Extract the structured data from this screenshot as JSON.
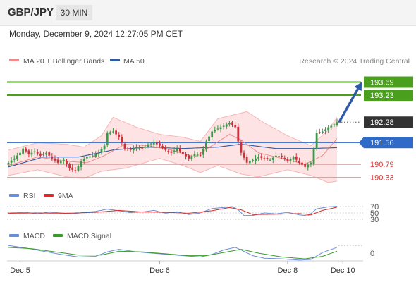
{
  "header": {
    "pair": "GBP/JPY",
    "timeframe": "30 MIN"
  },
  "datetime": "Monday, December 9, 2024 12:27:05 PM CET",
  "source": "Research © 2024 Trading Central",
  "colors": {
    "green": "#4aa01c",
    "blue_level": "#2f6ac8",
    "red_level": "#e88f8f",
    "arrow": "#2e5aa8",
    "candle_up": "#3a9a4a",
    "candle_down": "#c9313b",
    "rsi": "#6b8ed8",
    "rsi_ma": "#d62c2c",
    "macd": "#6b8ed8",
    "macd_signal": "#3a9a2a"
  },
  "chart_data": {
    "type": "candlestick",
    "price_range": [
      189.95,
      194.15
    ],
    "legend": [
      {
        "label": "MA 20 + Bollinger Bands",
        "color": "#f08a8a"
      },
      {
        "label": "MA 50",
        "color": "#2d5aa0"
      }
    ],
    "levels": [
      {
        "value": 193.69,
        "label": "193.69",
        "style": "green"
      },
      {
        "value": 193.23,
        "label": "193.23",
        "style": "green"
      },
      {
        "value": 192.28,
        "label": "192.28",
        "style": "current"
      },
      {
        "value": 191.56,
        "label": "191.56",
        "style": "blue"
      },
      {
        "value": 190.79,
        "label": "190.79",
        "style": "red"
      },
      {
        "value": 190.33,
        "label": "190.33",
        "style": "red"
      }
    ],
    "forecast_arrow": {
      "from": 192.28,
      "to": 193.69
    },
    "x_ticks": [
      {
        "label": "Dec 5",
        "bar": 4
      },
      {
        "label": "Dec 6",
        "bar": 52
      },
      {
        "label": "Dec 8",
        "bar": 96
      },
      {
        "label": "Dec 10",
        "bar": 115
      }
    ],
    "series": [
      {
        "name": "close",
        "anchors": [
          [
            0,
            190.85
          ],
          [
            2,
            191.0
          ],
          [
            4,
            191.2
          ],
          [
            5,
            191.35
          ],
          [
            7,
            191.15
          ],
          [
            9,
            191.25
          ],
          [
            11,
            191.1
          ],
          [
            13,
            191.2
          ],
          [
            15,
            191.0
          ],
          [
            17,
            190.85
          ],
          [
            19,
            190.95
          ],
          [
            21,
            190.65
          ],
          [
            23,
            190.55
          ],
          [
            25,
            190.9
          ],
          [
            27,
            191.05
          ],
          [
            29,
            191.1
          ],
          [
            31,
            191.2
          ],
          [
            33,
            191.45
          ],
          [
            34,
            191.9
          ],
          [
            36,
            191.95
          ],
          [
            38,
            191.75
          ],
          [
            40,
            191.35
          ],
          [
            42,
            191.3
          ],
          [
            44,
            191.4
          ],
          [
            46,
            191.35
          ],
          [
            48,
            191.5
          ],
          [
            50,
            191.55
          ],
          [
            52,
            191.45
          ],
          [
            54,
            191.3
          ],
          [
            56,
            191.2
          ],
          [
            58,
            191.35
          ],
          [
            60,
            191.15
          ],
          [
            62,
            191.0
          ],
          [
            64,
            191.15
          ],
          [
            66,
            191.1
          ],
          [
            68,
            191.6
          ],
          [
            70,
            191.95
          ],
          [
            72,
            192.05
          ],
          [
            74,
            192.15
          ],
          [
            76,
            192.25
          ],
          [
            78,
            192.1
          ],
          [
            79,
            191.6
          ],
          [
            80,
            191.2
          ],
          [
            82,
            190.85
          ],
          [
            84,
            190.95
          ],
          [
            86,
            191.05
          ],
          [
            88,
            191.0
          ],
          [
            90,
            190.95
          ],
          [
            92,
            191.1
          ],
          [
            94,
            191.05
          ],
          [
            96,
            190.9
          ],
          [
            98,
            191.05
          ],
          [
            100,
            190.85
          ],
          [
            102,
            190.7
          ],
          [
            104,
            190.85
          ],
          [
            105,
            191.35
          ],
          [
            106,
            191.9
          ],
          [
            108,
            191.95
          ],
          [
            110,
            192.1
          ],
          [
            112,
            192.2
          ],
          [
            113,
            192.28
          ]
        ]
      },
      {
        "name": "MA 20",
        "anchors": [
          [
            0,
            190.75
          ],
          [
            10,
            191.05
          ],
          [
            20,
            190.9
          ],
          [
            27,
            190.85
          ],
          [
            33,
            191.1
          ],
          [
            40,
            191.5
          ],
          [
            48,
            191.45
          ],
          [
            56,
            191.3
          ],
          [
            64,
            191.05
          ],
          [
            70,
            191.45
          ],
          [
            76,
            191.85
          ],
          [
            80,
            191.65
          ],
          [
            86,
            191.2
          ],
          [
            94,
            191.0
          ],
          [
            102,
            190.8
          ],
          [
            108,
            191.1
          ],
          [
            113,
            191.7
          ]
        ]
      },
      {
        "name": "MA 50",
        "anchors": [
          [
            0,
            190.7
          ],
          [
            12,
            191.05
          ],
          [
            24,
            191.05
          ],
          [
            36,
            191.3
          ],
          [
            48,
            191.4
          ],
          [
            60,
            191.35
          ],
          [
            72,
            191.4
          ],
          [
            80,
            191.5
          ],
          [
            92,
            191.35
          ],
          [
            104,
            191.35
          ],
          [
            113,
            191.38
          ]
        ]
      },
      {
        "name": "Bollinger upper",
        "anchors": [
          [
            0,
            191.3
          ],
          [
            10,
            191.55
          ],
          [
            20,
            191.5
          ],
          [
            26,
            191.4
          ],
          [
            32,
            191.8
          ],
          [
            36,
            192.45
          ],
          [
            44,
            192.1
          ],
          [
            52,
            191.85
          ],
          [
            60,
            191.75
          ],
          [
            66,
            191.6
          ],
          [
            72,
            192.4
          ],
          [
            78,
            192.55
          ],
          [
            82,
            192.65
          ],
          [
            88,
            192.25
          ],
          [
            96,
            191.8
          ],
          [
            104,
            191.45
          ],
          [
            110,
            192.0
          ],
          [
            113,
            192.45
          ]
        ]
      },
      {
        "name": "Bollinger lower",
        "anchors": [
          [
            0,
            190.4
          ],
          [
            10,
            190.6
          ],
          [
            20,
            190.35
          ],
          [
            26,
            190.3
          ],
          [
            32,
            190.55
          ],
          [
            40,
            190.65
          ],
          [
            52,
            191.0
          ],
          [
            60,
            190.75
          ],
          [
            66,
            190.5
          ],
          [
            72,
            190.75
          ],
          [
            80,
            190.45
          ],
          [
            86,
            190.35
          ],
          [
            96,
            190.6
          ],
          [
            104,
            190.4
          ],
          [
            110,
            190.15
          ],
          [
            113,
            190.2
          ]
        ]
      }
    ],
    "rsi": {
      "label": "RSI",
      "ma_label": "9MA",
      "ticks": [
        "70",
        "50",
        "30"
      ],
      "rsi_anchors": [
        [
          0,
          50
        ],
        [
          6,
          52
        ],
        [
          10,
          47
        ],
        [
          14,
          53
        ],
        [
          18,
          50
        ],
        [
          22,
          47
        ],
        [
          26,
          52
        ],
        [
          30,
          55
        ],
        [
          34,
          62
        ],
        [
          38,
          57
        ],
        [
          42,
          51
        ],
        [
          46,
          53
        ],
        [
          50,
          58
        ],
        [
          54,
          49
        ],
        [
          58,
          54
        ],
        [
          62,
          45
        ],
        [
          66,
          50
        ],
        [
          70,
          64
        ],
        [
          74,
          67
        ],
        [
          77,
          70
        ],
        [
          79,
          60
        ],
        [
          81,
          42
        ],
        [
          84,
          42
        ],
        [
          88,
          50
        ],
        [
          92,
          47
        ],
        [
          96,
          52
        ],
        [
          100,
          44
        ],
        [
          103,
          41
        ],
        [
          106,
          63
        ],
        [
          110,
          69
        ],
        [
          113,
          71
        ]
      ],
      "ma_anchors": [
        [
          0,
          49
        ],
        [
          10,
          50
        ],
        [
          20,
          49
        ],
        [
          30,
          52
        ],
        [
          38,
          58
        ],
        [
          46,
          53
        ],
        [
          54,
          52
        ],
        [
          62,
          49
        ],
        [
          70,
          57
        ],
        [
          76,
          67
        ],
        [
          80,
          60
        ],
        [
          84,
          45
        ],
        [
          92,
          46
        ],
        [
          100,
          48
        ],
        [
          104,
          44
        ],
        [
          108,
          58
        ],
        [
          113,
          68
        ]
      ]
    },
    "macd": {
      "label": "MACD",
      "signal_label": "MACD Signal",
      "zero_label": "0",
      "macd_anchors": [
        [
          0,
          0.12
        ],
        [
          6,
          0.08
        ],
        [
          12,
          0.03
        ],
        [
          18,
          -0.02
        ],
        [
          24,
          -0.06
        ],
        [
          30,
          -0.05
        ],
        [
          34,
          0.02
        ],
        [
          38,
          0.06
        ],
        [
          44,
          0.02
        ],
        [
          52,
          -0.01
        ],
        [
          60,
          -0.04
        ],
        [
          66,
          -0.06
        ],
        [
          70,
          -0.02
        ],
        [
          74,
          0.05
        ],
        [
          78,
          0.09
        ],
        [
          80,
          0.05
        ],
        [
          84,
          -0.04
        ],
        [
          88,
          -0.08
        ],
        [
          94,
          -0.09
        ],
        [
          100,
          -0.11
        ],
        [
          104,
          -0.1
        ],
        [
          108,
          0.01
        ],
        [
          113,
          0.09
        ]
      ],
      "signal_anchors": [
        [
          0,
          0.09
        ],
        [
          8,
          0.07
        ],
        [
          16,
          0.02
        ],
        [
          24,
          -0.03
        ],
        [
          32,
          -0.03
        ],
        [
          38,
          0.03
        ],
        [
          46,
          0.02
        ],
        [
          54,
          -0.01
        ],
        [
          62,
          -0.04
        ],
        [
          68,
          -0.04
        ],
        [
          74,
          0.01
        ],
        [
          80,
          0.06
        ],
        [
          86,
          0.0
        ],
        [
          94,
          -0.06
        ],
        [
          102,
          -0.09
        ],
        [
          108,
          -0.05
        ],
        [
          113,
          0.03
        ]
      ]
    }
  }
}
